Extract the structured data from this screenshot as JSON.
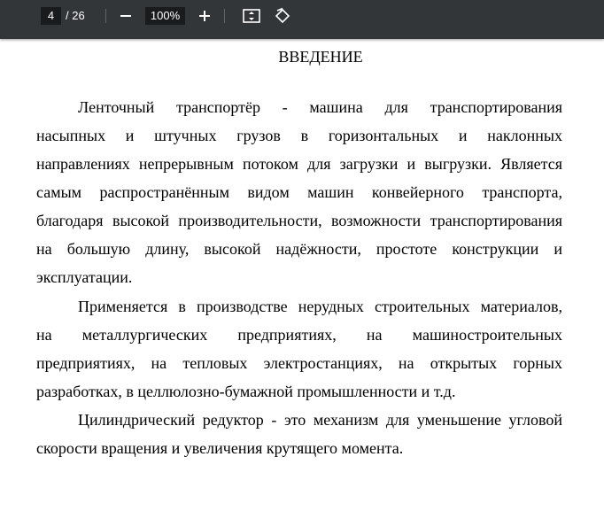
{
  "toolbar": {
    "page_current": "4",
    "page_total": "/ 26",
    "zoom": "100%"
  },
  "document": {
    "title": "ВВЕДЕНИЕ",
    "lines": [
      "Ленточный транспортёр - машина для транспортирования",
      "насыпных и штучных грузов в горизонтальных и наклонных",
      "направлениях непрерывным потоком для загрузки и выгрузки. Является",
      "самым распространённым видом машин конвейерного транспорта,",
      "благодаря высокой производительности, возможности транспортирования",
      "на большую длину, высокой надёжности, простоте конструкции и",
      "эксплуатации.",
      "Применяется в производстве нерудных строительных материалов,",
      "на металлургических предприятиях, на машиностроительных",
      "предприятиях, на тепловых электростанциях, на открытых горных",
      "разработках, в целлюлозно-бумажной промышленности и т.д.",
      "Цилиндрический редуктор - это механизм для уменьшение угловой",
      "скорости вращения и увеличения крутящего момента."
    ]
  }
}
